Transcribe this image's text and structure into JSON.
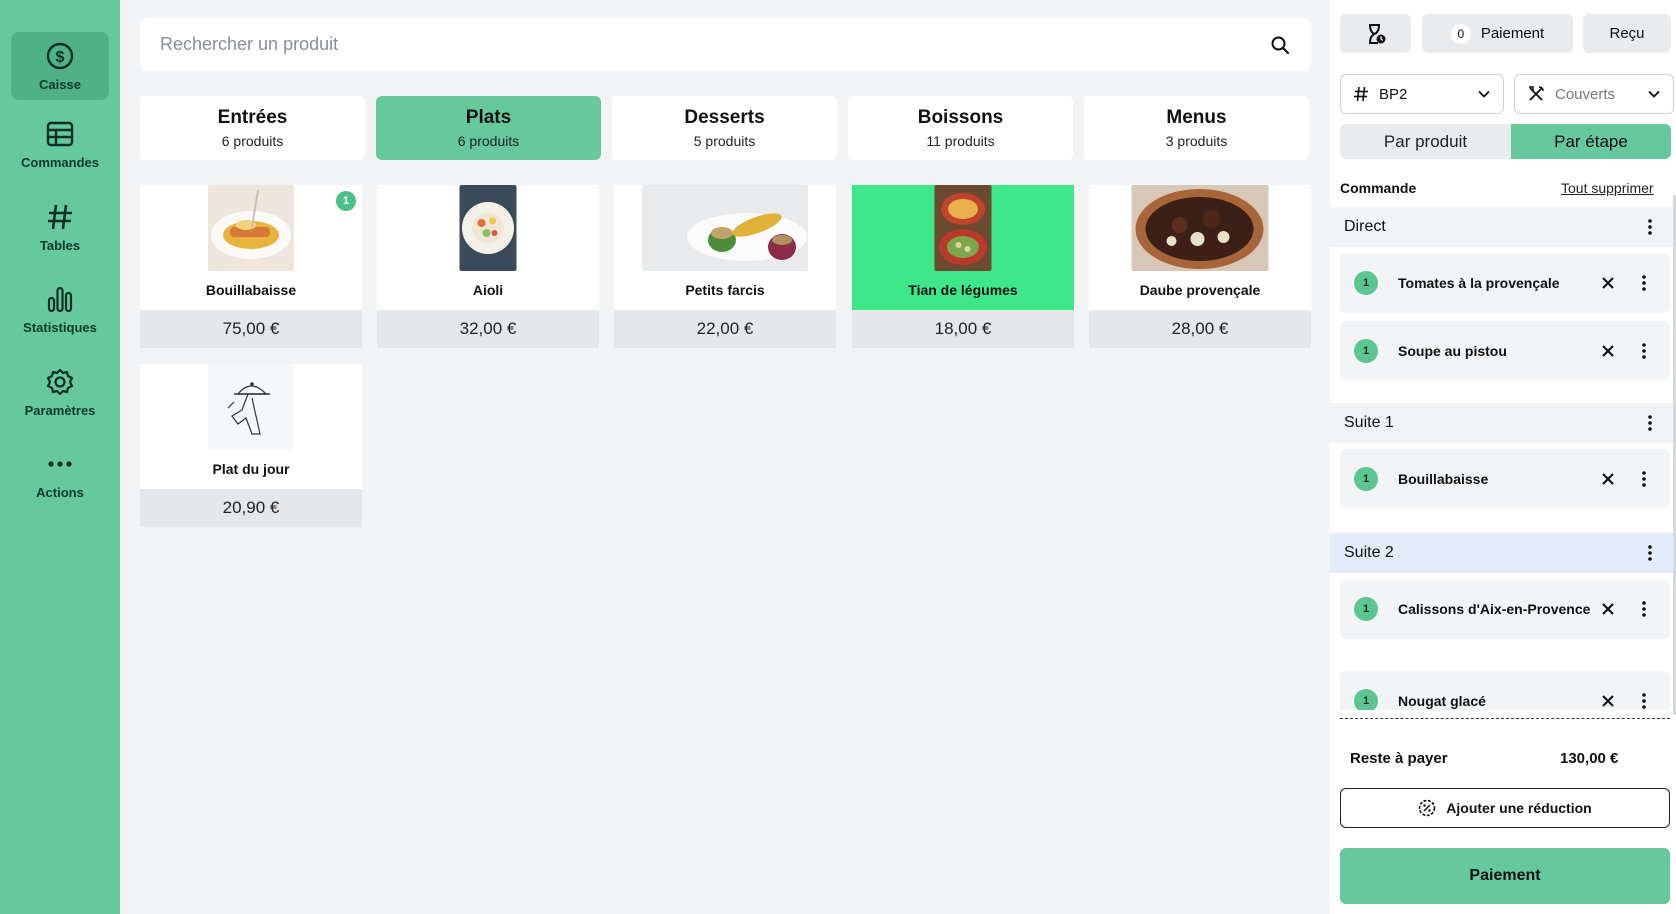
{
  "sidebar": {
    "items": [
      {
        "label": "Caisse",
        "icon": "dollar-circle-icon",
        "active": true
      },
      {
        "label": "Commandes",
        "icon": "table-grid-icon"
      },
      {
        "label": "Tables",
        "icon": "hash-icon"
      },
      {
        "label": "Statistiques",
        "icon": "bar-chart-icon"
      },
      {
        "label": "Paramètres",
        "icon": "gear-icon"
      },
      {
        "label": "Actions",
        "icon": "more-icon"
      }
    ]
  },
  "search": {
    "placeholder": "Rechercher un produit"
  },
  "categories": [
    {
      "name": "Entrées",
      "count": "6 produits"
    },
    {
      "name": "Plats",
      "count": "6 produits",
      "active": true
    },
    {
      "name": "Desserts",
      "count": "5 produits"
    },
    {
      "name": "Boissons",
      "count": "11 produits"
    },
    {
      "name": "Menus",
      "count": "3 produits"
    }
  ],
  "products": [
    {
      "name": "Bouillabaisse",
      "price": "75,00 €",
      "badge": "1"
    },
    {
      "name": "Aioli",
      "price": "32,00 €"
    },
    {
      "name": "Petits farcis",
      "price": "22,00 €"
    },
    {
      "name": "Tian de légumes",
      "price": "18,00 €",
      "active": true
    },
    {
      "name": "Daube provençale",
      "price": "28,00 €"
    },
    {
      "name": "Plat du jour",
      "price": "20,90 €"
    }
  ],
  "panel": {
    "payment_count": "0",
    "payment_label": "Paiement",
    "receipt_label": "Reçu",
    "table_value": "BP2",
    "covers_placeholder": "Couverts",
    "by_product": "Par produit",
    "by_step": "Par étape",
    "order_title": "Commande",
    "clear_all": "Tout supprimer",
    "sections": [
      {
        "title": "Direct",
        "items": [
          {
            "qty": "1",
            "name": "Tomates à la provençale"
          },
          {
            "qty": "1",
            "name": "Soupe au pistou"
          }
        ]
      },
      {
        "title": "Suite 1",
        "items": [
          {
            "qty": "1",
            "name": "Bouillabaisse"
          }
        ]
      },
      {
        "title": "Suite 2",
        "items": [
          {
            "qty": "1",
            "name": "Calissons d'Aix-en-Provence"
          },
          {
            "qty": "1",
            "name": "Nougat glacé"
          }
        ]
      }
    ],
    "remaining_label": "Reste à payer",
    "remaining_amount": "130,00 €",
    "discount_label": "Ajouter une réduction",
    "pay_button": "Paiement"
  },
  "colors": {
    "accent": "#66c99d",
    "selected_card": "#3ee88a",
    "badge": "#4fbf8a"
  }
}
